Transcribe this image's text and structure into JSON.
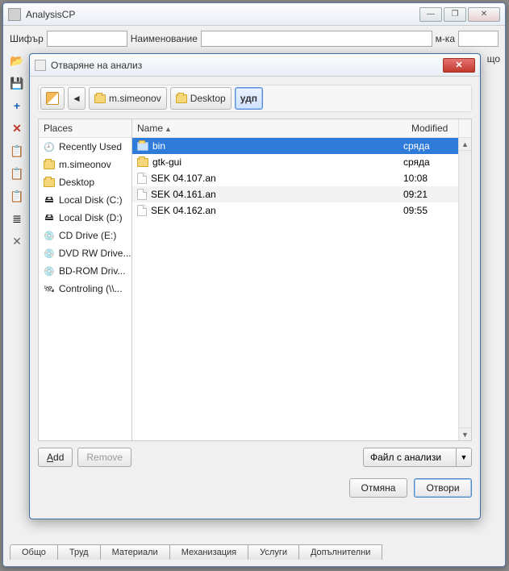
{
  "main": {
    "title": "AnalysisCP",
    "fields": {
      "cipher_label": "Шифър",
      "name_label": "Наименование",
      "unit_label": "м-ка"
    },
    "tabs": [
      "Общо",
      "Труд",
      "Материали",
      "Механизация",
      "Услуги",
      "Допълнителни"
    ],
    "truncated_right": "що"
  },
  "side_icons": [
    "folder-open",
    "save",
    "plus",
    "delete",
    "clipboard",
    "clipboard2",
    "clipboard3",
    "list",
    "wrench"
  ],
  "dialog": {
    "title": "Отваряне на анализ",
    "path": {
      "crumbs": [
        "m.simeonov",
        "Desktop",
        "удп"
      ],
      "active_index": 2
    },
    "places_header": "Places",
    "places": [
      {
        "icon": "recent",
        "label": "Recently Used"
      },
      {
        "icon": "folder",
        "label": "m.simeonov"
      },
      {
        "icon": "folder",
        "label": "Desktop"
      },
      {
        "icon": "disk",
        "label": "Local Disk (C:)"
      },
      {
        "icon": "disk",
        "label": "Local Disk (D:)"
      },
      {
        "icon": "cd",
        "label": "CD Drive (E:)"
      },
      {
        "icon": "dvd",
        "label": "DVD RW Drive..."
      },
      {
        "icon": "bd",
        "label": "BD-ROM Driv..."
      },
      {
        "icon": "net",
        "label": "Controling (\\\\..."
      }
    ],
    "cols": {
      "name": "Name",
      "modified": "Modified"
    },
    "rows": [
      {
        "type": "folder",
        "name": "bin",
        "mod": "сряда",
        "selected": true
      },
      {
        "type": "folder",
        "name": "gtk-gui",
        "mod": "сряда"
      },
      {
        "type": "file",
        "name": "SEK 04.107.an",
        "mod": "10:08"
      },
      {
        "type": "file",
        "name": "SEK 04.161.an",
        "mod": "09:21",
        "alt": true
      },
      {
        "type": "file",
        "name": "SEK 04.162.an",
        "mod": "09:55"
      }
    ],
    "add": "Add",
    "remove": "Remove",
    "filter": "Файл с анализи",
    "cancel": "Отмяна",
    "open": "Отвори"
  }
}
